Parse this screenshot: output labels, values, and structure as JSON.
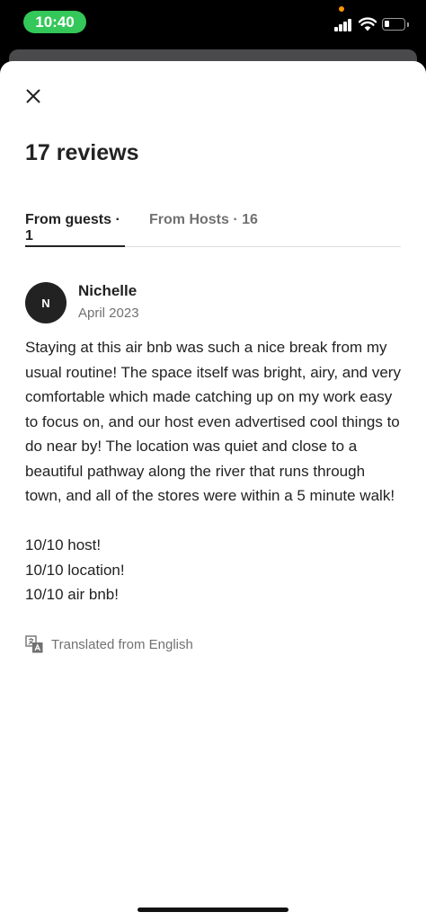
{
  "status_bar": {
    "time": "10:40"
  },
  "modal": {
    "title": "17 reviews",
    "tabs": [
      {
        "label": "From guests · 1",
        "active": true
      },
      {
        "label": "From Hosts · 16",
        "active": false
      }
    ]
  },
  "review": {
    "avatar_initial": "N",
    "reviewer_name": "Nichelle",
    "date": "April 2023",
    "body": "Staying at this air bnb was such a nice break from my usual routine! The space itself was bright, airy, and very comfortable which made catching up on my work easy to focus on, and our host even advertised cool things to do near by! The location was quiet and close to a beautiful pathway along the river that runs through town, and all of the stores were within a 5 minute walk!\n\n10/10 host!\n10/10 location!\n10/10 air bnb!",
    "translation_note": "Translated from English"
  },
  "colors": {
    "status_time_pill": "#34c759",
    "text_primary": "#222222",
    "text_secondary": "#717171",
    "avatar_bg": "#222222"
  },
  "icons": {
    "close": "close-icon",
    "translate": "translate-icon"
  }
}
